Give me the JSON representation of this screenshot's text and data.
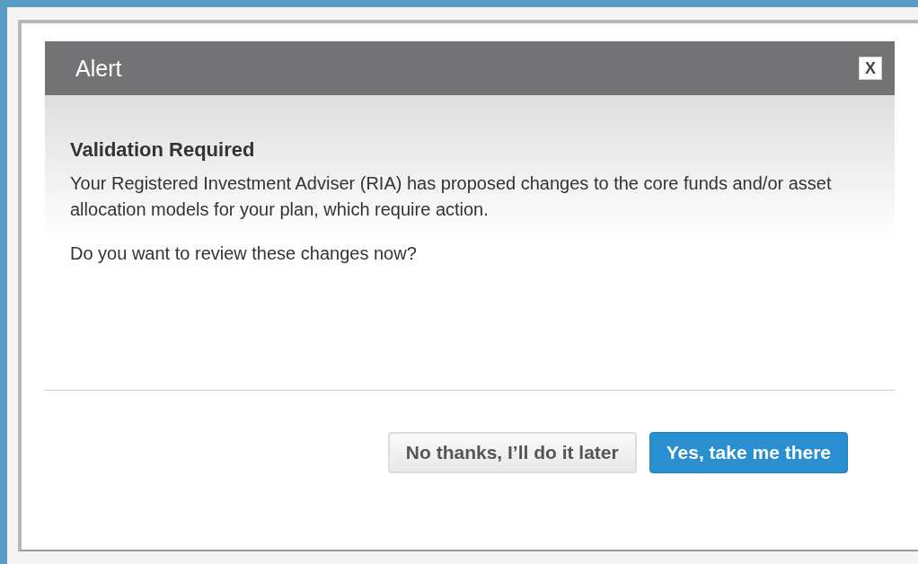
{
  "dialog": {
    "title": "Alert",
    "close": "X",
    "heading": "Validation Required",
    "paragraphs": [
      "Your Registered Investment Adviser (RIA) has proposed changes to the core funds and/or asset allocation models for your plan, which require action.",
      "Do you want to review these changes now?"
    ],
    "buttons": [
      {
        "label": "No thanks, I’ll do it later",
        "kind": "secondary"
      },
      {
        "label": "Yes, take me there",
        "kind": "primary"
      }
    ]
  }
}
